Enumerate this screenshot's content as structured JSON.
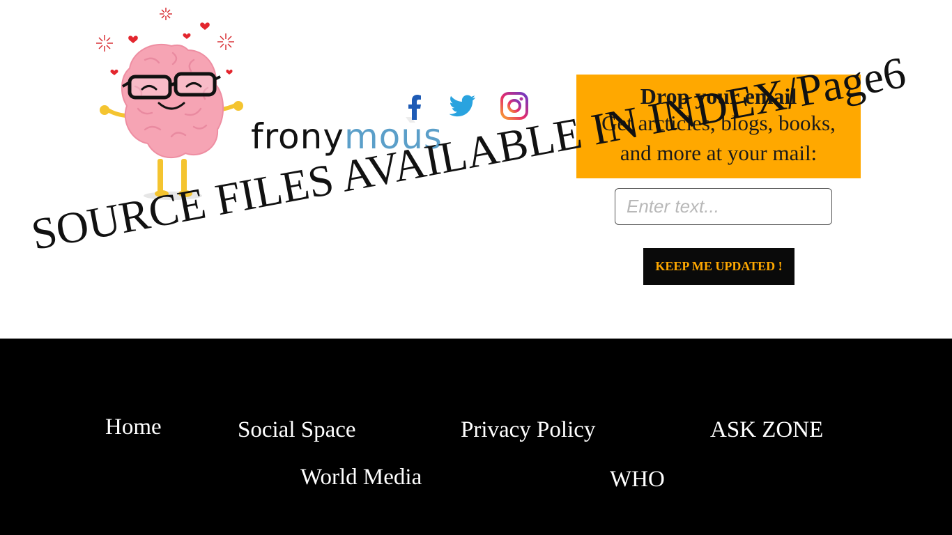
{
  "brand": {
    "part1": "frony",
    "part2": "mous"
  },
  "social": {
    "icons": [
      "facebook-icon",
      "twitter-icon",
      "instagram-icon"
    ]
  },
  "signup": {
    "heading": "Drop your email",
    "line1": "Get arcticles, blogs, books,",
    "line2": "and more at your mail:",
    "placeholder": "Enter text...",
    "button_label": "KEEP ME UPDATED !"
  },
  "banner": {
    "text": "SOURCE FILES AVAILABLE IN INDEX/Page6"
  },
  "footer": {
    "links": {
      "home": "Home",
      "social_space": "Social Space",
      "privacy_policy": "Privacy Policy",
      "ask_zone": "ASK ZONE",
      "world_media": "World Media",
      "who": "WHO"
    }
  },
  "colors": {
    "accent": "#ffa800",
    "footer_bg": "#000000",
    "brand_blue": "#5b9fc9"
  }
}
